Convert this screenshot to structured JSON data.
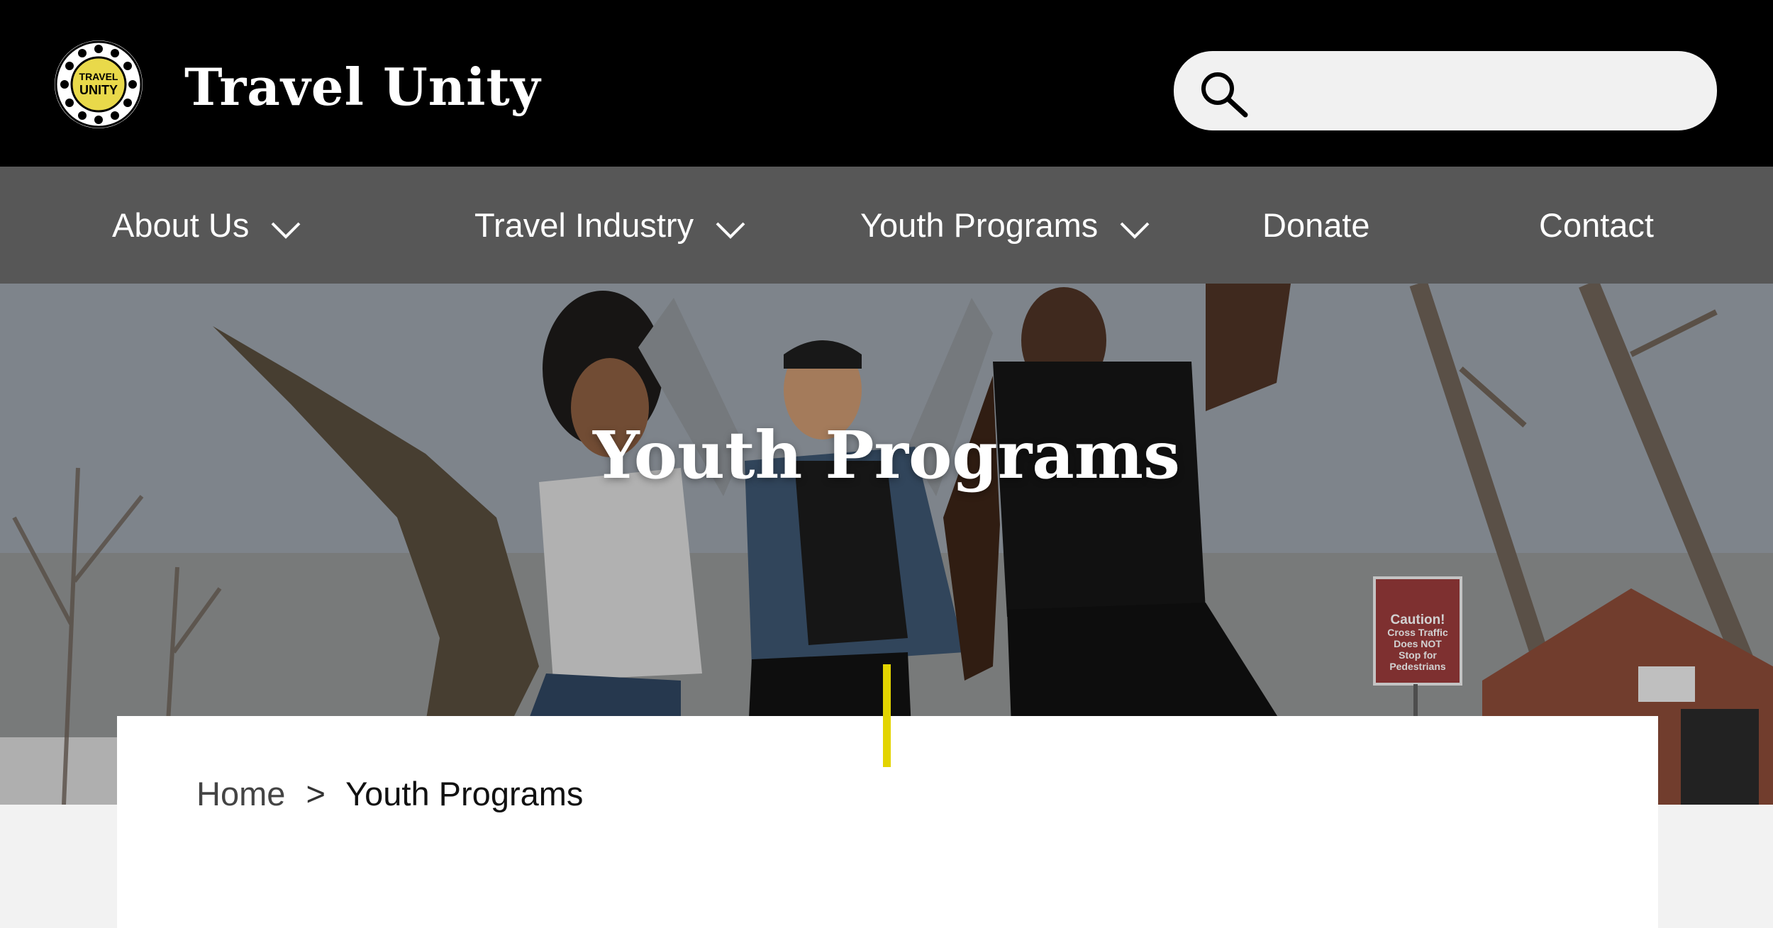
{
  "header": {
    "brand": "Travel Unity",
    "logo_text_top": "TRAVEL",
    "logo_text_bottom": "UNITY",
    "search": {
      "placeholder": "",
      "value": "",
      "icon": "search-icon"
    }
  },
  "nav": {
    "items": [
      {
        "label": "About Us",
        "has_dropdown": true
      },
      {
        "label": "Travel Industry",
        "has_dropdown": true
      },
      {
        "label": "Youth Programs",
        "has_dropdown": true
      },
      {
        "label": "Donate",
        "has_dropdown": false
      },
      {
        "label": "Contact",
        "has_dropdown": false
      }
    ]
  },
  "hero": {
    "title": "Youth Programs",
    "sign_lines": [
      "Caution!",
      "Cross Traffic",
      "Does NOT",
      "Stop for",
      "Pedestrians"
    ]
  },
  "breadcrumb": {
    "home": "Home",
    "separator": ">",
    "current": "Youth Programs"
  },
  "colors": {
    "topbar": "#000000",
    "navbar": "#575757",
    "accent": "#e3d400",
    "logo_yellow": "#e9d94a"
  }
}
